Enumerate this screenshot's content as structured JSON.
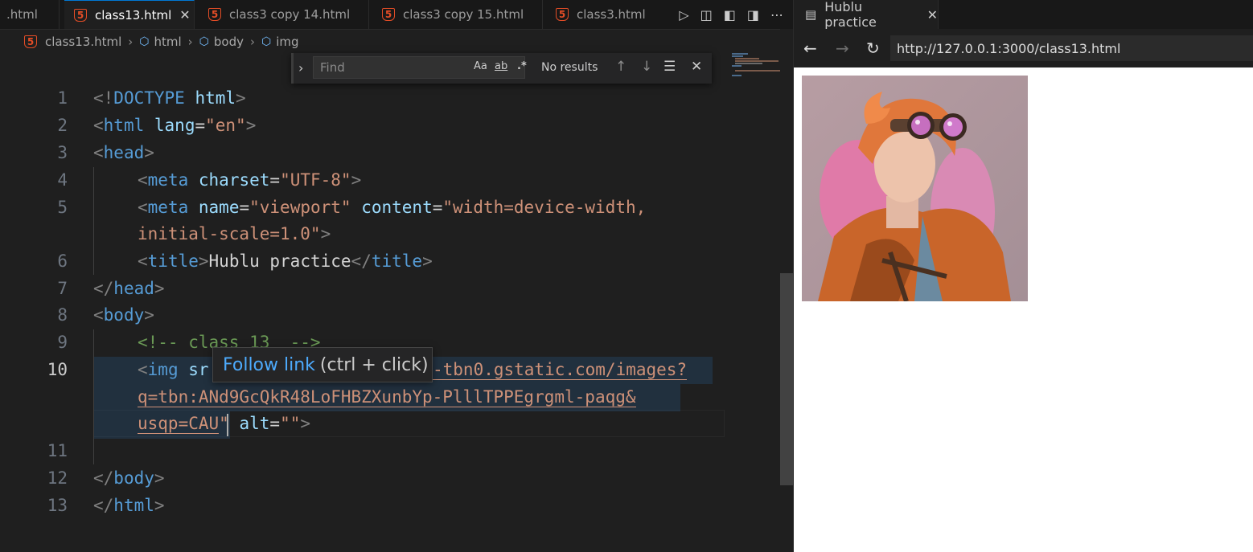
{
  "editor": {
    "tabs": [
      {
        "label": ".html",
        "active": false
      },
      {
        "label": "class13.html",
        "active": true
      },
      {
        "label": "class3 copy 14.html",
        "active": false
      },
      {
        "label": "class3 copy 15.html",
        "active": false
      },
      {
        "label": "class3.html",
        "active": false
      }
    ],
    "breadcrumb": [
      "class13.html",
      "html",
      "body",
      "img"
    ],
    "find": {
      "placeholder": "Find",
      "opt_case": "Aa",
      "opt_word": "ab",
      "opt_regex": ".*",
      "result": "No results"
    },
    "tooltip": {
      "link": "Follow link",
      "hint": "(ctrl + click)"
    },
    "line_numbers": [
      "1",
      "2",
      "3",
      "4",
      "5",
      "6",
      "7",
      "8",
      "9",
      "10",
      "11",
      "12",
      "13"
    ],
    "code": {
      "l1": {
        "p1": "<!",
        "kw": "DOCTYPE",
        "sp": " ",
        "attr": "html",
        "p2": ">"
      },
      "l2": {
        "p1": "<",
        "tag": "html",
        "sp": " ",
        "attr": "lang",
        "eq": "=",
        "val": "\"en\"",
        "p2": ">"
      },
      "l3": {
        "p1": "<",
        "tag": "head",
        "p2": ">"
      },
      "l4": {
        "p1": "<",
        "tag": "meta",
        "sp": " ",
        "attr": "charset",
        "eq": "=",
        "val": "\"UTF-8\"",
        "p2": ">"
      },
      "l5a": {
        "p1": "<",
        "tag": "meta",
        "sp": " ",
        "attr": "name",
        "eq": "=",
        "val": "\"viewport\"",
        "sp2": " ",
        "attr2": "content",
        "eq2": "=",
        "val2": "\"width=device-width,"
      },
      "l5b": {
        "val": "initial-scale=1.0\"",
        "p2": ">"
      },
      "l6": {
        "p1": "<",
        "tag": "title",
        "p2": ">",
        "text": "Hublu practice",
        "p3": "</",
        "tag2": "title",
        "p4": ">"
      },
      "l7": {
        "p1": "</",
        "tag": "head",
        "p2": ">"
      },
      "l8": {
        "p1": "<",
        "tag": "body",
        "p2": ">"
      },
      "l9": {
        "comment": "<!-- class 13  -->"
      },
      "l10a": {
        "p1": "<",
        "tag": "img",
        "sp": " ",
        "attr": "sr",
        "val": "-tbn0.gstatic.com/images?"
      },
      "l10b": {
        "val": "q=tbn:ANd9GcQkR48LoFHBZXunbYp-PlllTPPEgrgml-paqg&"
      },
      "l10c": {
        "val": "usqp=CAU",
        "q": "\"",
        "sp": " ",
        "attr": "alt",
        "eq": "=",
        "val2": "\"\"",
        "p2": ">"
      },
      "l12": {
        "p1": "</",
        "tag": "body",
        "p2": ">"
      },
      "l13": {
        "p1": "</",
        "tag": "html",
        "p2": ">"
      }
    }
  },
  "preview": {
    "tab_title": "Hublu practice",
    "url": "http://127.0.0.1:3000/class13.html"
  }
}
